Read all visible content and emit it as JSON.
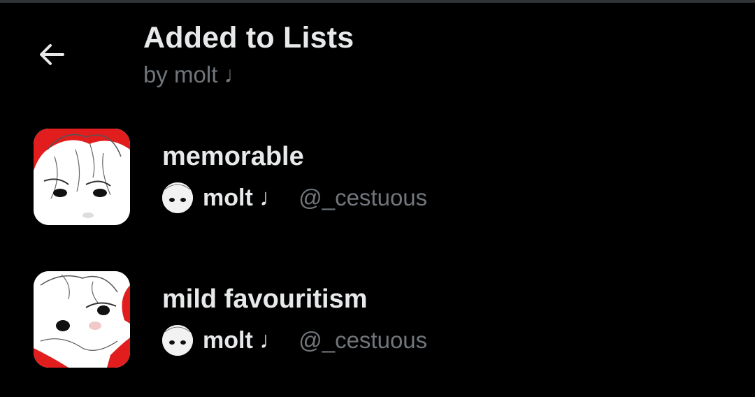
{
  "header": {
    "title": "Added to Lists",
    "subtitle": "by molt ♩",
    "back_icon": "arrow-left-icon"
  },
  "lists": [
    {
      "name": "memorable",
      "owner_name": "molt ♩",
      "owner_handle": "@_cestuous"
    },
    {
      "name": "mild favouritism",
      "owner_name": "molt ♩",
      "owner_handle": "@_cestuous"
    }
  ],
  "colors": {
    "background": "#000000",
    "primary_text": "#e7e9ea",
    "secondary_text": "#71767b",
    "thumbnail_accent": "#e11d1d"
  }
}
